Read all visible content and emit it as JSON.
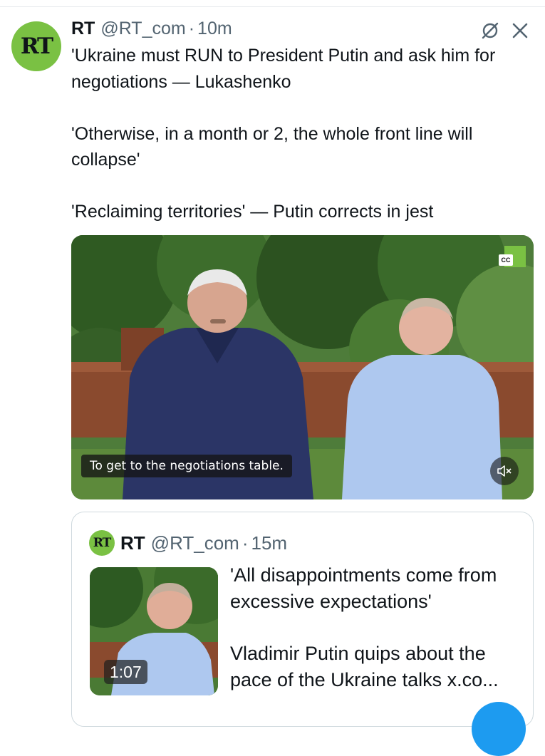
{
  "tweet": {
    "author_name": "RT",
    "author_handle": "@RT_com",
    "separator": "·",
    "time": "10m",
    "avatar_text": "RT",
    "paragraphs": [
      "'Ukraine must RUN to President Putin and ask him for negotiations — Lukashenko",
      "'Otherwise, in a month or 2, the whole front line will collapse'",
      "'Reclaiming territories' — Putin corrects in jest"
    ],
    "actions": {
      "grok_icon": "slashed-circle-icon",
      "close_icon": "close-icon"
    }
  },
  "video": {
    "subtitle": "To get to the negotiations table.",
    "cc_label": "CC",
    "mute_icon": "speaker-muted-icon"
  },
  "quoted_tweet": {
    "avatar_text": "RT",
    "author_name": "RT",
    "author_handle": "@RT_com",
    "separator": "·",
    "time": "15m",
    "duration": "1:07",
    "paragraphs": [
      "'All disappointments come from excessive expectations'",
      "Vladimir Putin quips about the pace of the Ukraine talks x.co..."
    ]
  },
  "colors": {
    "rt_green": "#7ac143",
    "text": "#0f1419",
    "muted": "#536471",
    "border": "#cfd9de",
    "accent_blue": "#1d9bf0"
  }
}
